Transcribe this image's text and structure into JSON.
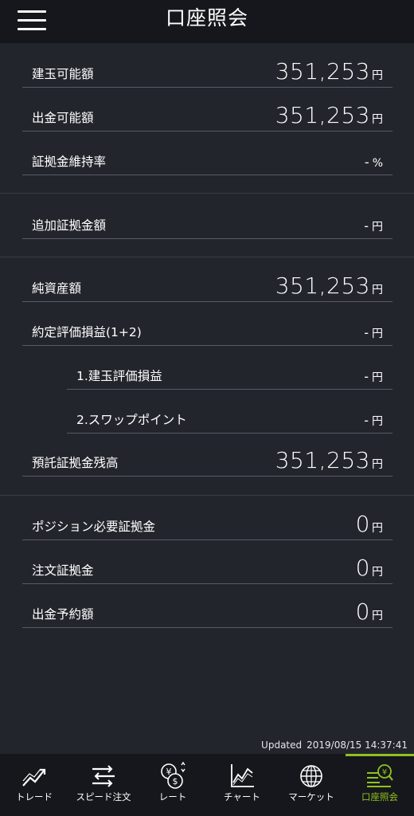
{
  "header": {
    "title": "口座照会"
  },
  "account": {
    "rows": [
      {
        "label": "建玉可能額",
        "value": "351,253",
        "unit": "円"
      },
      {
        "label": "出金可能額",
        "value": "351,253",
        "unit": "円"
      },
      {
        "label": "証拠金維持率",
        "value": "-",
        "unit": "%"
      },
      {
        "label": "追加証拠金額",
        "value": "-",
        "unit": "円"
      },
      {
        "label": "純資産額",
        "value": "351,253",
        "unit": "円"
      },
      {
        "label": "約定評価損益(1+2)",
        "value": "-",
        "unit": "円"
      },
      {
        "label": "1.建玉評価損益",
        "value": "-",
        "unit": "円"
      },
      {
        "label": "2.スワップポイント",
        "value": "-",
        "unit": "円"
      },
      {
        "label": "預託証拠金残高",
        "value": "351,253",
        "unit": "円"
      },
      {
        "label": "ポジション必要証拠金",
        "value": "0",
        "unit": "円"
      },
      {
        "label": "注文証拠金",
        "value": "0",
        "unit": "円"
      },
      {
        "label": "出金予約額",
        "value": "0",
        "unit": "円"
      }
    ]
  },
  "status": {
    "updated_label": "Updated",
    "updated_time": "2019/08/15 14:37:41"
  },
  "nav": {
    "items": [
      {
        "label": "トレード",
        "icon": "trade-chart-icon"
      },
      {
        "label": "スピード注文",
        "icon": "speed-order-icon"
      },
      {
        "label": "レート",
        "icon": "rate-currency-icon"
      },
      {
        "label": "チャート",
        "icon": "line-chart-icon"
      },
      {
        "label": "マーケット",
        "icon": "globe-icon"
      },
      {
        "label": "口座照会",
        "icon": "account-inquiry-icon"
      }
    ],
    "active_index": 5,
    "active_color": "#8fc21f"
  }
}
